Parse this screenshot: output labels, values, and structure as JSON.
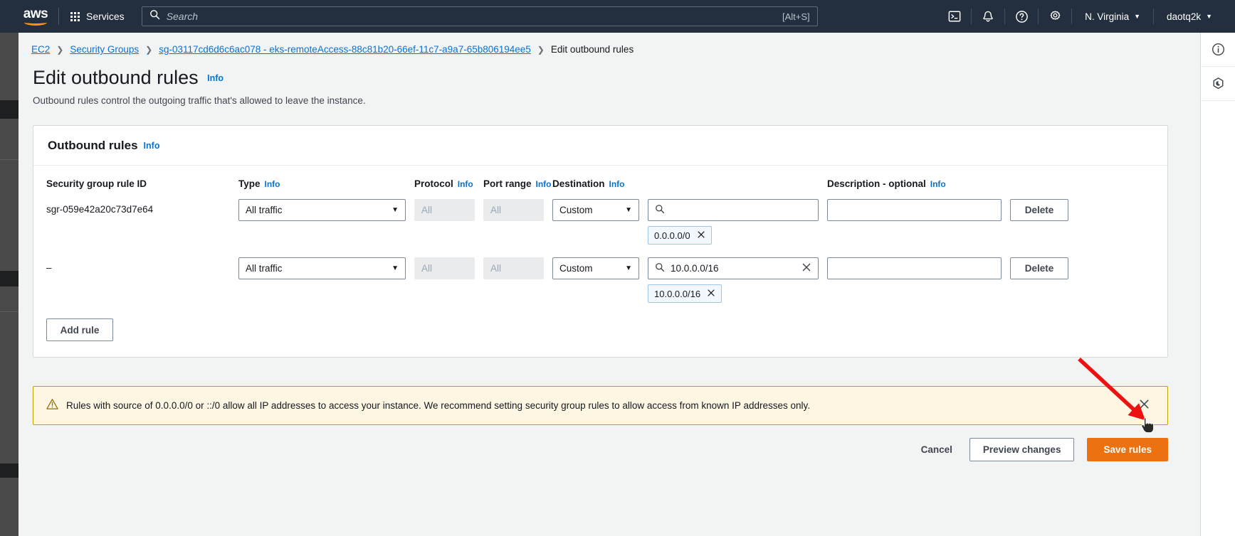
{
  "topnav": {
    "logo_text": "aws",
    "services_label": "Services",
    "search_placeholder": "Search",
    "search_shortcut": "[Alt+S]",
    "icons": [
      "cloudshell-icon",
      "bell-icon",
      "help-icon",
      "settings-icon"
    ],
    "region": "N. Virginia",
    "account": "daotq2k",
    "caret": "▼"
  },
  "breadcrumb": {
    "items": [
      {
        "label": "EC2",
        "link": true
      },
      {
        "label": "Security Groups",
        "link": true
      },
      {
        "label": "sg-03117cd6d6c6ac078 - eks-remoteAccess-88c81b20-66ef-11c7-a9a7-65b806194ee5",
        "link": true
      },
      {
        "label": "Edit outbound rules",
        "link": false
      }
    ],
    "separator": "❯"
  },
  "header": {
    "title": "Edit outbound rules",
    "info_label": "Info",
    "subtitle": "Outbound rules control the outgoing traffic that's allowed to leave the instance."
  },
  "card": {
    "title": "Outbound rules",
    "info_label": "Info",
    "columns": [
      {
        "label": "Security group rule ID",
        "info": false
      },
      {
        "label": "Type",
        "info": true
      },
      {
        "label": "Protocol",
        "info": true
      },
      {
        "label": "Port range",
        "info": true
      },
      {
        "label": "Destination",
        "info": true
      },
      {
        "label": "Description - optional",
        "info": true
      }
    ],
    "info_label_text": "Info",
    "rows": [
      {
        "rule_id": "sgr-059e42a20c73d7e64",
        "type": "All traffic",
        "protocol": "All",
        "port_range": "All",
        "destination_mode": "Custom",
        "destination_value": "",
        "destination_tag": "0.0.0.0/0",
        "has_clear": false,
        "description": "",
        "delete_label": "Delete"
      },
      {
        "rule_id": "–",
        "type": "All traffic",
        "protocol": "All",
        "port_range": "All",
        "destination_mode": "Custom",
        "destination_value": "10.0.0.0/16",
        "destination_tag": "10.0.0.0/16",
        "has_clear": true,
        "description": "",
        "delete_label": "Delete"
      }
    ],
    "add_rule_label": "Add rule",
    "select_arrow": "▼",
    "tag_close": "✕"
  },
  "alert": {
    "message": "Rules with source of 0.0.0.0/0 or ::/0 allow all IP addresses to access your instance. We recommend setting security group rules to allow access from known IP addresses only.",
    "icon": "warning-triangle-icon",
    "dismiss_icon": "close-icon",
    "border_color": "#bea300",
    "background_color": "#fdf6e3"
  },
  "footer": {
    "cancel_label": "Cancel",
    "preview_label": "Preview changes",
    "save_label": "Save rules",
    "save_color": "#ec7211"
  },
  "rail": {
    "icons": [
      "info-circle-icon",
      "shield-icon"
    ]
  },
  "colors": {
    "nav_background": "#232f3e",
    "link": "#0972d3",
    "page_background": "#f2f3f3",
    "annotation_arrow": "#ee1111"
  }
}
